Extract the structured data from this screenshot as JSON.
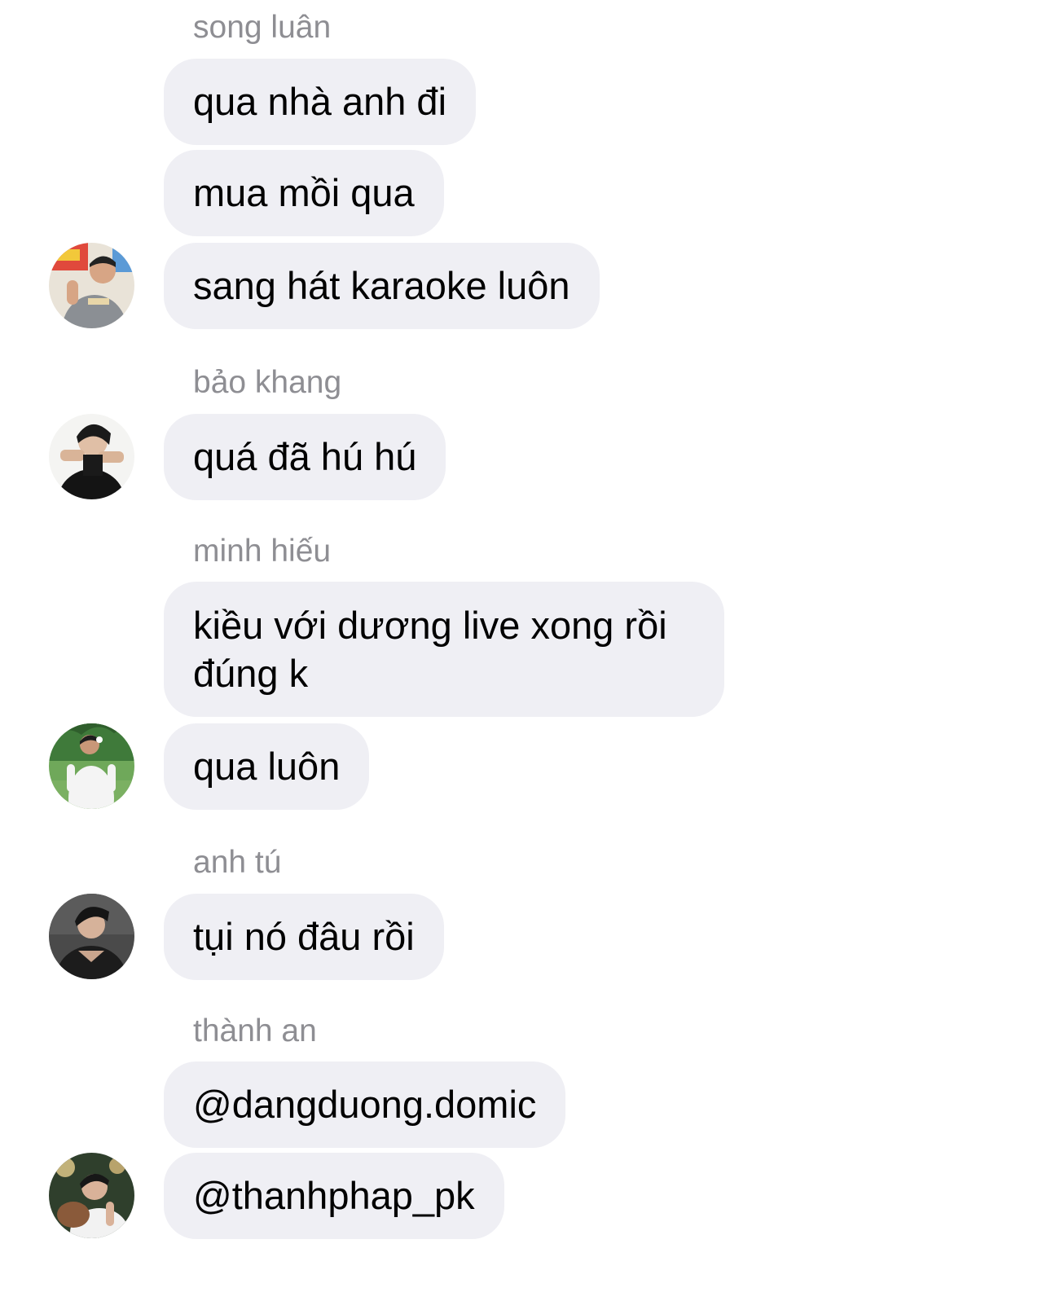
{
  "messages": [
    {
      "sender": "song luân",
      "bubbles": [
        "qua nhà anh đi",
        "mua mồi qua",
        "sang hát karaoke luôn"
      ],
      "avatar": "avatar-song-luan"
    },
    {
      "sender": "bảo khang",
      "bubbles": [
        "quá đã hú hú"
      ],
      "avatar": "avatar-bao-khang"
    },
    {
      "sender": "minh hiếu",
      "bubbles": [
        "kiều với dương live xong rồi đúng k",
        "qua luôn"
      ],
      "avatar": "avatar-minh-hieu"
    },
    {
      "sender": "anh tú",
      "bubbles": [
        "tụi nó đâu rồi"
      ],
      "avatar": "avatar-anh-tu"
    },
    {
      "sender": "thành an",
      "bubbles": [
        "@dangduong.domic",
        "@thanhphap_pk"
      ],
      "avatar": "avatar-thanh-an"
    }
  ],
  "colors": {
    "bubble_bg": "#efeff4",
    "sender_text": "#8e8e93",
    "message_text": "#000000"
  }
}
